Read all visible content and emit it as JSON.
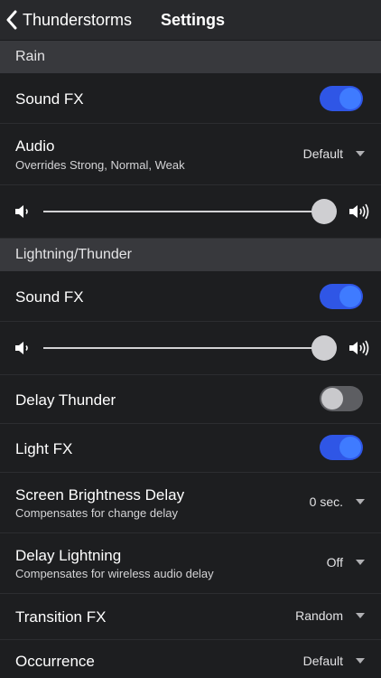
{
  "nav": {
    "back_label": "Thunderstorms",
    "title": "Settings"
  },
  "rain": {
    "header": "Rain",
    "sound_fx": {
      "label": "Sound FX",
      "on": true
    },
    "audio": {
      "label": "Audio",
      "subtitle": "Overrides Strong, Normal, Weak",
      "value": "Default"
    },
    "volume": {
      "level": 1.0
    }
  },
  "lightning": {
    "header": "Lightning/Thunder",
    "sound_fx": {
      "label": "Sound FX",
      "on": true
    },
    "volume": {
      "level": 1.0
    },
    "delay_thunder": {
      "label": "Delay Thunder",
      "on": false
    },
    "light_fx": {
      "label": "Light FX",
      "on": true
    },
    "screen_brightness_delay": {
      "label": "Screen Brightness Delay",
      "subtitle": "Compensates for change delay",
      "value": "0 sec."
    },
    "delay_lightning": {
      "label": "Delay Lightning",
      "subtitle": "Compensates for wireless audio delay",
      "value": "Off"
    },
    "transition_fx": {
      "label": "Transition FX",
      "value": "Random"
    },
    "occurrence": {
      "label": "Occurrence",
      "value": "Default"
    }
  },
  "colors": {
    "accent": "#2f56e6",
    "knob_on": "#3f7bff",
    "background": "#1d1e20",
    "header": "#38393d"
  },
  "icons": [
    "chevron-left-icon",
    "volume-low-icon",
    "volume-high-icon",
    "caret-down-icon"
  ]
}
